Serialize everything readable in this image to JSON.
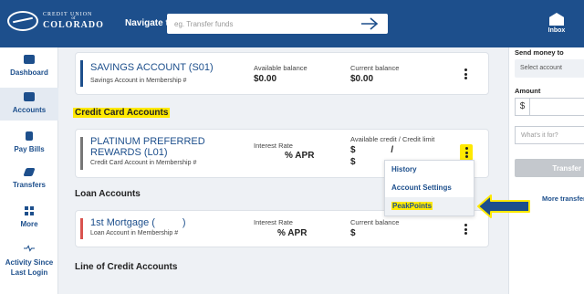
{
  "header": {
    "logo_top": "CREDIT UNION",
    "logo_mid": "of",
    "logo_bottom": "COLORADO",
    "nav_label": "Navigate to",
    "search_placeholder": "eg. Transfer funds",
    "inbox_label": "Inbox"
  },
  "sidebar": {
    "items": [
      {
        "label": "Dashboard",
        "icon": "bank-icon"
      },
      {
        "label": "Accounts",
        "icon": "accounts-icon",
        "active": true
      },
      {
        "label": "Pay Bills",
        "icon": "dollar-icon"
      },
      {
        "label": "Transfers",
        "icon": "transfer-icon"
      },
      {
        "label": "More",
        "icon": "grid-icon"
      },
      {
        "label": "Activity Since Last Login",
        "icon": "pulse-icon"
      }
    ]
  },
  "savings": {
    "name": "SAVINGS ACCOUNT (S01)",
    "sub": "Savings Account in Membership #",
    "available_label": "Available balance",
    "available_value": "$0.00",
    "current_label": "Current balance",
    "current_value": "$0.00"
  },
  "sections": {
    "credit_card": "Credit Card Accounts",
    "loan": "Loan Accounts",
    "line_of_credit": "Line of Credit Accounts"
  },
  "credit_card": {
    "name_line1": "PLATINUM PREFERRED",
    "name_line2": "REWARDS (L01)",
    "sub": "Credit Card Account in Membership #",
    "rate_label": "Interest Rate",
    "rate_value": "% APR",
    "avail_label": "Available credit / Credit limit",
    "avail_value": "$ /",
    "avail_value2": "$"
  },
  "menu": {
    "items": [
      "History",
      "Account Settings",
      "PeakPoints"
    ]
  },
  "mortgage": {
    "name": "1st Mortgage (",
    "name_end": ")",
    "sub": "Loan Account in Membership #",
    "rate_label": "Interest Rate",
    "rate_value": "% APR",
    "current_label": "Current balance",
    "current_value": "$"
  },
  "right_panel": {
    "send_label": "Send money to",
    "select_placeholder": "Select account",
    "amount_label": "Amount",
    "dollar": "$",
    "memo_placeholder": "What's it for?",
    "transfer_button": "Transfer",
    "more_link": "More transfers"
  },
  "colors": {
    "brand": "#1d4f8c",
    "highlight": "#ffe900",
    "savings_bar": "#1d4f8c",
    "credit_bar": "#777777",
    "loan_bar": "#d9534f"
  }
}
